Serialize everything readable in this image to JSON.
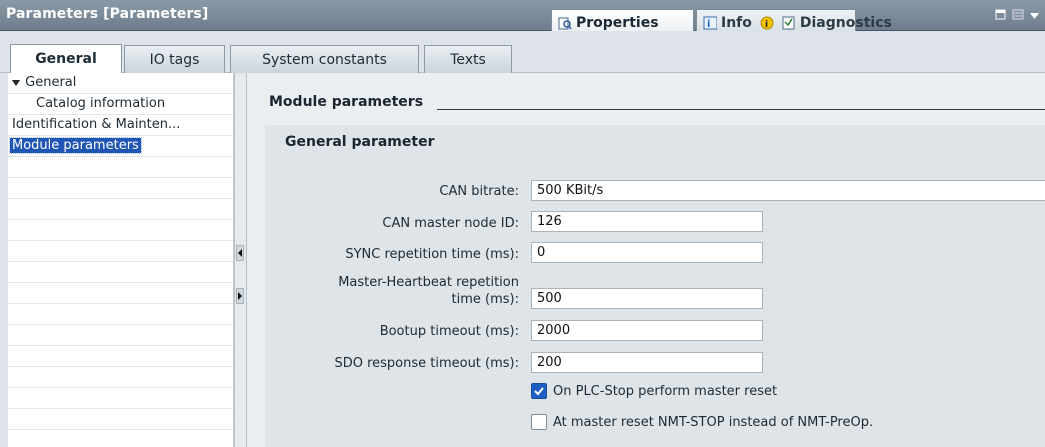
{
  "window": {
    "title": "Parameters [Parameters]",
    "tabs": [
      {
        "label": "Properties",
        "icon": "properties-icon"
      },
      {
        "label": "Info",
        "icon": "info-icon"
      },
      {
        "label": "Diagnostics",
        "icon": "diagnostics-icon"
      }
    ]
  },
  "subtabs": [
    "General",
    "IO tags",
    "System constants",
    "Texts"
  ],
  "nav": {
    "items": [
      "General",
      "Catalog information",
      "Identification & Mainten...",
      "Module parameters"
    ]
  },
  "section": {
    "title": "Module parameters",
    "group_title": "General parameter"
  },
  "fields": [
    {
      "label": "CAN bitrate:",
      "value": "500 KBit/s"
    },
    {
      "label": "CAN master node ID:",
      "value": "126"
    },
    {
      "label": "SYNC repetition time (ms):",
      "value": "0"
    },
    {
      "label_line1": "Master-Heartbeat repetition",
      "label_line2": "time (ms):",
      "value": "500"
    },
    {
      "label": "Bootup timeout (ms):",
      "value": "2000"
    },
    {
      "label": "SDO response timeout (ms):",
      "value": "200"
    }
  ],
  "checkboxes": [
    {
      "label": "On PLC-Stop perform master reset",
      "checked": true
    },
    {
      "label": "At master reset NMT-STOP instead of NMT-PreOp.",
      "checked": false
    }
  ],
  "colors": {
    "accent": "#1f56b5",
    "titlebar": "#7b8a97"
  }
}
